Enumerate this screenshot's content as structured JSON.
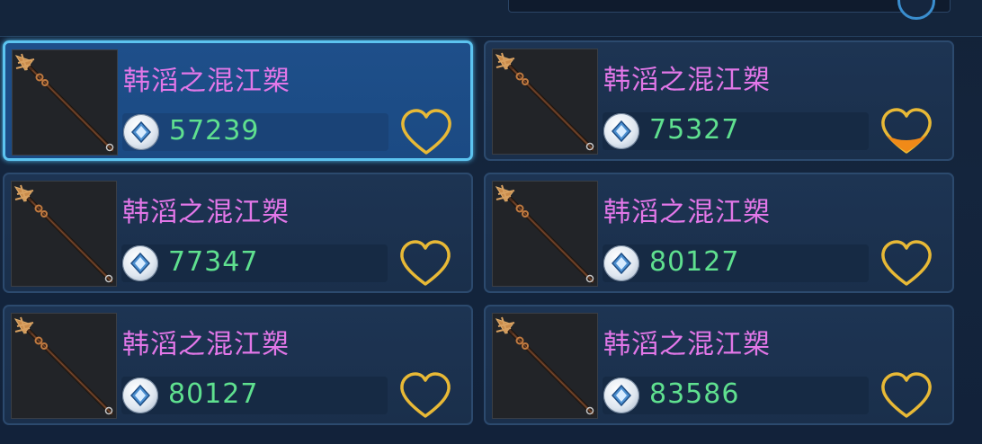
{
  "items": [
    {
      "name": "韩滔之混江槊",
      "price": "57239",
      "selected": true,
      "favorited": false
    },
    {
      "name": "韩滔之混江槊",
      "price": "75327",
      "selected": false,
      "favorited": true
    },
    {
      "name": "韩滔之混江槊",
      "price": "77347",
      "selected": false,
      "favorited": false
    },
    {
      "name": "韩滔之混江槊",
      "price": "80127",
      "selected": false,
      "favorited": false
    },
    {
      "name": "韩滔之混江槊",
      "price": "80127",
      "selected": false,
      "favorited": false
    },
    {
      "name": "韩滔之混江槊",
      "price": "83586",
      "selected": false,
      "favorited": false
    }
  ],
  "icons": {
    "currency": "silver-coin-icon",
    "favorite": "heart-icon",
    "item": "spear-icon"
  },
  "colors": {
    "name": "#e277e8",
    "price": "#5fe08f",
    "heart": "#e8b936",
    "heart_fill": "#f08a18",
    "selected_border": "#5cc4f0"
  }
}
